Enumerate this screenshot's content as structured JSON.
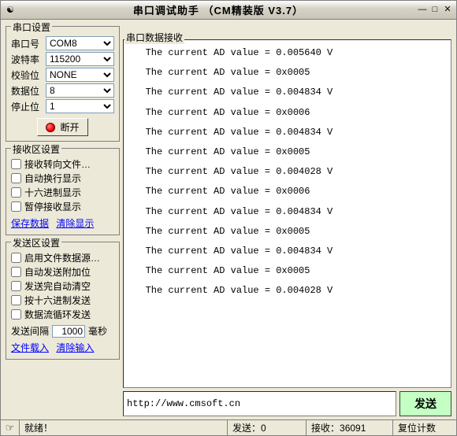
{
  "window": {
    "title": "串口调试助手 （CM精装版 V3.7）"
  },
  "port_settings": {
    "legend": "串口设置",
    "com_label": "串口号",
    "com_value": "COM8",
    "baud_label": "波特率",
    "baud_value": "115200",
    "parity_label": "校验位",
    "parity_value": "NONE",
    "databits_label": "数据位",
    "databits_value": "8",
    "stopbits_label": "停止位",
    "stopbits_value": "1",
    "disconnect_label": "断开"
  },
  "rx_settings": {
    "legend": "接收区设置",
    "to_file": "接收转向文件…",
    "auto_wrap": "自动换行显示",
    "hex_disp": "十六进制显示",
    "pause_disp": "暂停接收显示",
    "save_link": "保存数据",
    "clear_link": "清除显示"
  },
  "tx_settings": {
    "legend": "发送区设置",
    "file_src": "启用文件数据源…",
    "auto_append": "自动发送附加位",
    "auto_clear": "发送完自动清空",
    "hex_send": "按十六进制发送",
    "loop_send": "数据流循环发送",
    "interval_label": "发送间隔",
    "interval_value": "1000",
    "interval_unit": "毫秒",
    "load_file": "文件载入",
    "clear_input": "清除输入"
  },
  "rx_area": {
    "legend": "串口数据接收",
    "lines": [
      "   The current AD value = 0.005640 V",
      "   The current AD value = 0x0005",
      "   The current AD value = 0.004834 V",
      "   The current AD value = 0x0006",
      "   The current AD value = 0.004834 V",
      "   The current AD value = 0x0005",
      "   The current AD value = 0.004028 V",
      "   The current AD value = 0x0006",
      "   The current AD value = 0.004834 V",
      "   The current AD value = 0x0005",
      "   The current AD value = 0.004834 V",
      "   The current AD value = 0x0005",
      "   The current AD value = 0.004028 V"
    ]
  },
  "send_area": {
    "value": "http://www.cmsoft.cn",
    "button": "发送"
  },
  "statusbar": {
    "ready": "就绪！",
    "tx_label": "发送：",
    "tx_count": "0",
    "rx_label": "接收：",
    "rx_count": "36091",
    "reset_label": "复位计数"
  }
}
